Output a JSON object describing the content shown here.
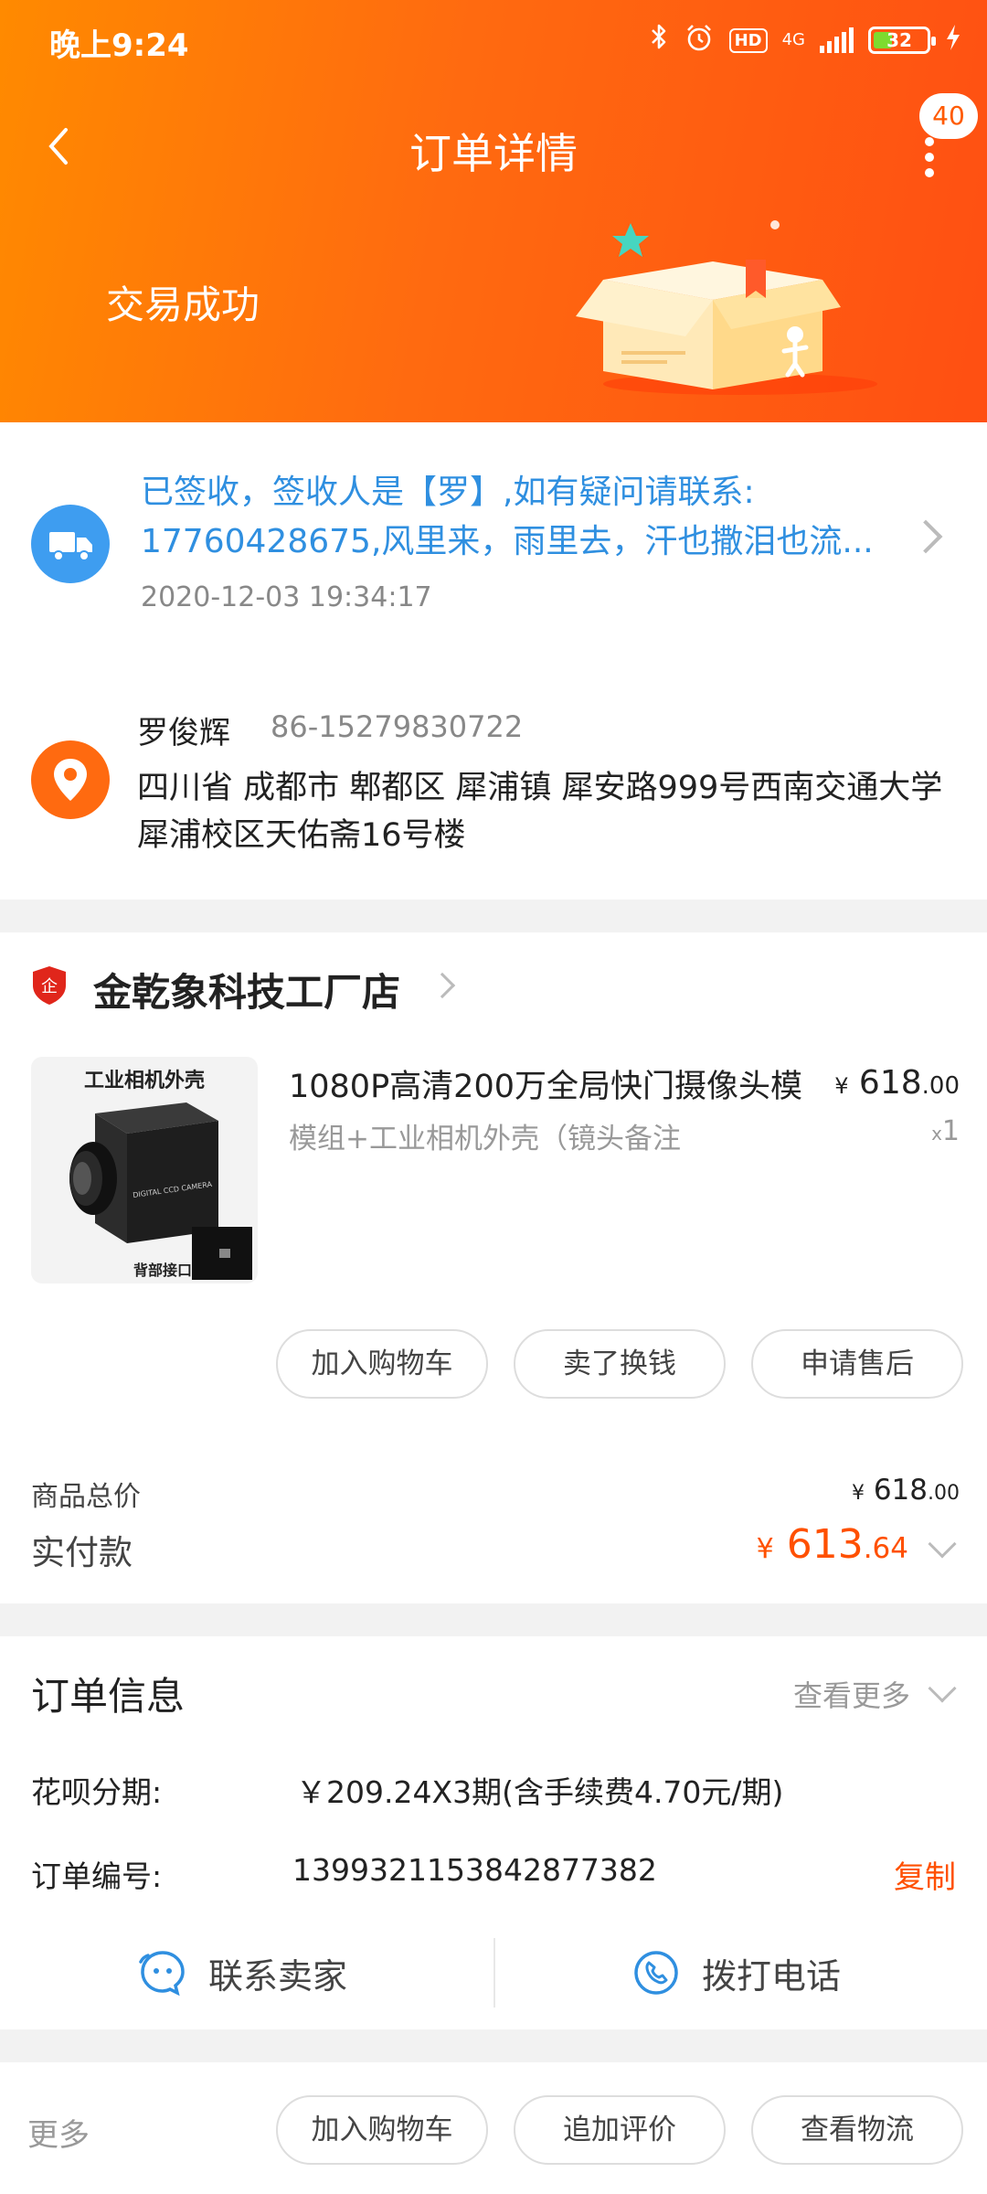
{
  "status_bar": {
    "time": "晚上9:24",
    "net": "4G",
    "battery": "32"
  },
  "header": {
    "title": "订单详情",
    "badge": "40",
    "trade_status": "交易成功"
  },
  "logistics": {
    "line1": "已签收，签收人是【罗】,如有疑问请联系:",
    "line2": "17760428675,风里来，雨里去，汗也撒泪也流...",
    "time": "2020-12-03 19:34:17"
  },
  "receiver": {
    "name": "罗俊辉",
    "phone": "86-15279830722",
    "address": "四川省 成都市 郫都区 犀浦镇 犀安路999号西南交通大学犀浦校区天佑斋16号楼"
  },
  "shop": {
    "name": "金乾象科技工厂店",
    "logo_text": "企"
  },
  "product": {
    "thumb_caption": "工业相机外壳",
    "thumb_back": "背部接口",
    "camera_text": "DIGITAL CCD CAMERA",
    "title": "1080P高清200万全局快门摄像头模",
    "sku": "模组+工业相机外壳（镜头备注",
    "price_yen": "¥",
    "price_int": "618",
    "price_dec": ".00",
    "qty_x": "x",
    "qty": "1"
  },
  "product_actions": [
    "加入购物车",
    "卖了换钱",
    "申请售后"
  ],
  "totals": {
    "goods_label": "商品总价",
    "goods_yen": "¥",
    "goods_int": "618",
    "goods_dec": ".00",
    "paid_label": "实付款",
    "paid_yen": "¥",
    "paid_int": "613",
    "paid_dec": ".64"
  },
  "order_info": {
    "title": "订单信息",
    "see_more": "查看更多",
    "installment_label": "花呗分期:",
    "installment_value": "￥209.24X3期(含手续费4.70元/期)",
    "order_no_label": "订单编号:",
    "order_no": "1399321153842877382",
    "copy": "复制"
  },
  "contact": {
    "seller": "联系卖家",
    "call": "拨打电话"
  },
  "bottom_bar": {
    "more": "更多",
    "actions": [
      "加入购物车",
      "追加评价",
      "查看物流"
    ]
  },
  "colors": {
    "accent": "#ff5000",
    "header_start": "#ff8a00",
    "header_end": "#ff4f12",
    "link_blue": "#2f8fe0"
  }
}
